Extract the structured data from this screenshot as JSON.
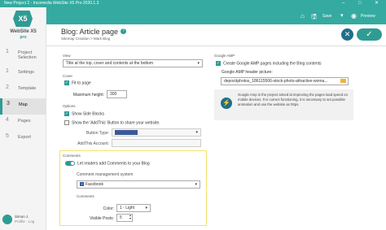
{
  "window": {
    "title": "New Project 2 - Incomedia WebSite X5 Pro 2020.1.3",
    "minimize": "–",
    "maximize": "□",
    "close": "✕"
  },
  "brand": {
    "line1": "WebSite X5",
    "line2": "pro",
    "logo": "X5"
  },
  "steps": [
    {
      "num": "1",
      "label": "Project Selection"
    },
    {
      "num": "1",
      "label": "Settings"
    },
    {
      "num": "2",
      "label": "Template"
    },
    {
      "num": "3",
      "label": "Map"
    },
    {
      "num": "4",
      "label": "Pages"
    },
    {
      "num": "5",
      "label": "Export"
    }
  ],
  "user": {
    "name": "Simon J.",
    "sub": "Profile · Log"
  },
  "toolbar": {
    "save": "Save",
    "preview": "Preview"
  },
  "header": {
    "title": "Blog: Article page",
    "breadcrumb": "Sitemap Creation > Mark Blog",
    "cancel": "✕",
    "ok": "✓"
  },
  "view": {
    "section": "View",
    "value": "Title at the top, cover and contents at the bottom"
  },
  "cover": {
    "section": "Cover",
    "fit_label": "Fit to page",
    "maxheight_label": "Maximum height:",
    "maxheight_value": "300"
  },
  "options": {
    "section": "Options",
    "show_side_blocks": "Show Side Blocks",
    "show_addthis": "Show the 'AddThis' Button to share your website.",
    "button_type_label": "Button Type:",
    "addthis_account_label": "AddThis Account:"
  },
  "comments": {
    "section": "Comments",
    "toggle_label": "Let readers add Comments to your Blog",
    "system_label": "Comment management system",
    "system_value": "Facebook",
    "sub_section": "Comments",
    "color_label": "Color:",
    "color_value": "1 - Light",
    "posts_label": "Visible Posts:",
    "posts_value": "5"
  },
  "amp": {
    "section": "Google AMP",
    "create_label": "Create Google AMP pages including the Blog contents",
    "header_label": "Google AMP header picture:",
    "header_value": "depos\\tphotos_186115506-stock-photo-attractive-woma...",
    "info": "Google Amp is the project aimed at improving the pages load speed on mobile devices. For correct functioning, it is necessary to set possible animation and use the website as https."
  },
  "colors": {
    "accent": "#35aaa0",
    "highlight": "#f2e36a"
  }
}
